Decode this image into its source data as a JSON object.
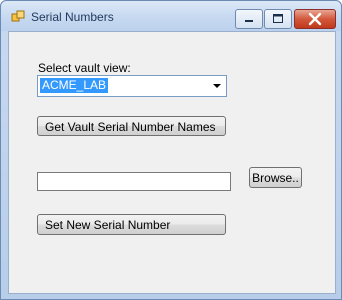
{
  "window": {
    "title": "Serial Numbers"
  },
  "form": {
    "vault_label": "Select vault view:",
    "vault_value": "ACME_LAB",
    "get_vault_button": "Get Vault Serial Number Names",
    "file_path_value": "",
    "browse_button": "Browse..",
    "set_new_button": "Set New Serial Number"
  },
  "icons": {
    "app": "app-window-icon",
    "minimize": "minimize-icon",
    "maximize": "maximize-icon",
    "close": "close-icon",
    "dropdown": "chevron-down-icon"
  },
  "colors": {
    "selection": "#3399ff",
    "close_button": "#c0391b"
  }
}
